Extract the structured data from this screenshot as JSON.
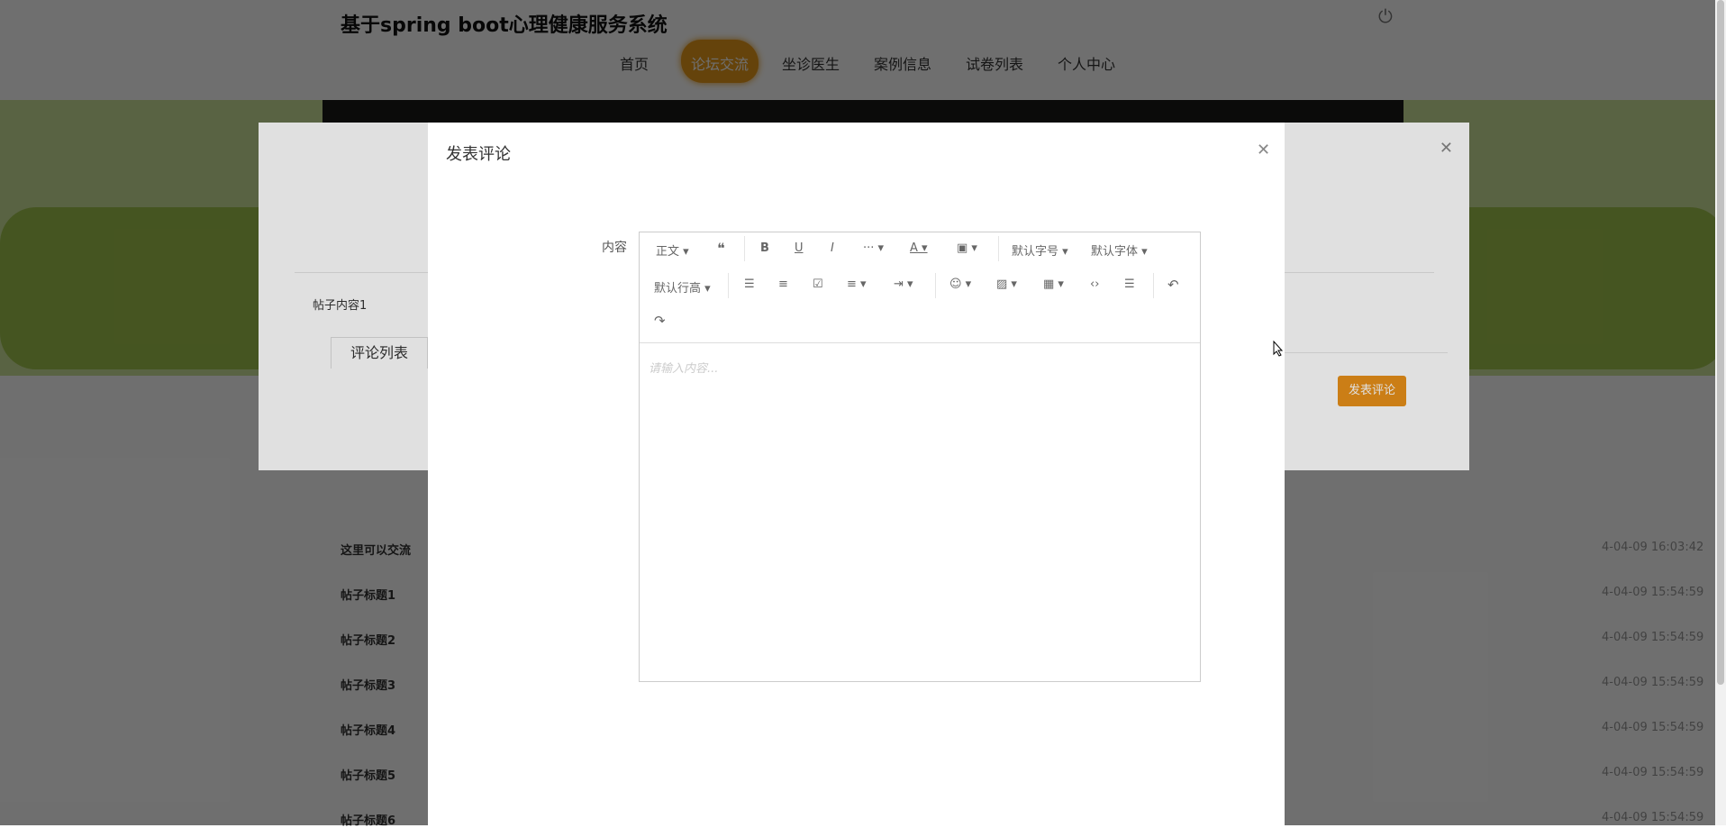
{
  "site": {
    "title": "基于spring boot心理健康服务系统"
  },
  "nav": [
    {
      "label": "首页"
    },
    {
      "label": "论坛交流",
      "active": true
    },
    {
      "label": "坐诊医生"
    },
    {
      "label": "案例信息"
    },
    {
      "label": "试卷列表"
    },
    {
      "label": "个人中心"
    }
  ],
  "back_dialog": {
    "post_content": "帖子内容1",
    "comments_tab": "评论列表",
    "post_comment_button": "发表评论"
  },
  "forum_list": [
    {
      "title": "这里可以交流",
      "date": "4-04-09 16:03:42"
    },
    {
      "title": "帖子标题1",
      "date": "4-04-09 15:54:59"
    },
    {
      "title": "帖子标题2",
      "date": "4-04-09 15:54:59"
    },
    {
      "title": "帖子标题3",
      "date": "4-04-09 15:54:59"
    },
    {
      "title": "帖子标题4",
      "date": "4-04-09 15:54:59"
    },
    {
      "title": "帖子标题5",
      "date": "4-04-09 15:54:59"
    },
    {
      "title": "帖子标题6",
      "date": "4-04-09 15:54:59"
    }
  ],
  "modal": {
    "title": "发表评论",
    "field_label": "内容",
    "editor": {
      "placeholder": "请输入内容...",
      "paragraph": "正文",
      "font_size": "默认字号",
      "font_family": "默认字体",
      "line_height": "默认行高"
    }
  },
  "colors": {
    "accent": "#e8901a",
    "green_light": "#cde29a",
    "green_dark": "#9fc24c"
  }
}
